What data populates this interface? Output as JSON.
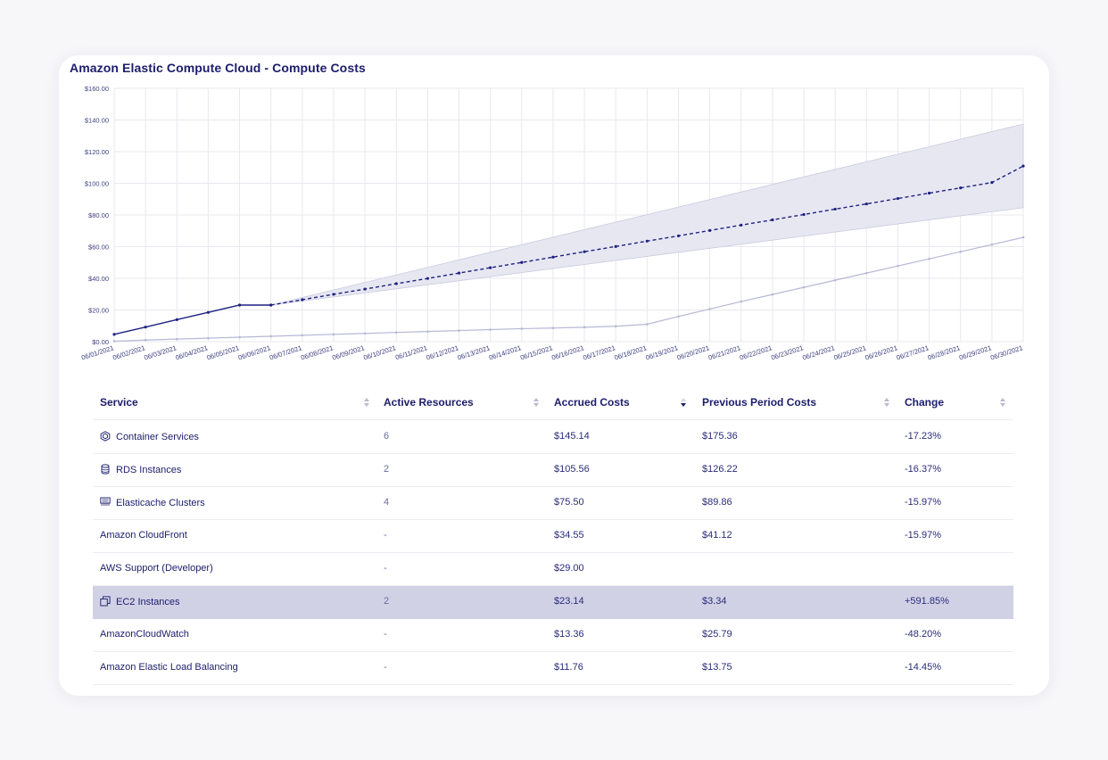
{
  "title": "Amazon Elastic Compute Cloud - Compute Costs",
  "chart_data": {
    "type": "line",
    "x": [
      "06/01/2021",
      "06/02/2021",
      "06/03/2021",
      "06/04/2021",
      "06/05/2021",
      "06/06/2021",
      "06/07/2021",
      "06/08/2021",
      "06/09/2021",
      "06/10/2021",
      "06/11/2021",
      "06/12/2021",
      "06/13/2021",
      "06/14/2021",
      "06/15/2021",
      "06/16/2021",
      "06/17/2021",
      "06/18/2021",
      "06/19/2021",
      "06/20/2021",
      "06/21/2021",
      "06/22/2021",
      "06/23/2021",
      "06/24/2021",
      "06/25/2021",
      "06/26/2021",
      "06/27/2021",
      "06/28/2021",
      "06/29/2021",
      "06/30/2021"
    ],
    "y_ticks": [
      "$0.00",
      "$20.00",
      "$40.00",
      "$60.00",
      "$80.00",
      "$100.00",
      "$120.00",
      "$140.00",
      "$160.00"
    ],
    "ylim": [
      0,
      160
    ],
    "grid": true,
    "series": [
      {
        "style": "solid",
        "color": "#1f2280",
        "values": [
          4.6,
          9.2,
          13.9,
          18.5,
          23.1,
          23.1
        ]
      },
      {
        "style": "dashed",
        "color": "#1f2280",
        "start_index": 5,
        "values": [
          23.1,
          26.5,
          29.9,
          33.2,
          36.6,
          39.9,
          43.3,
          46.7,
          50.0,
          53.4,
          56.8,
          60.1,
          63.5,
          66.8,
          70.2,
          73.6,
          76.9,
          80.3,
          83.7,
          87.0,
          90.4,
          93.8,
          97.1,
          100.5,
          110.9
        ]
      },
      {
        "style": "faint",
        "color": "#b7b8d6",
        "values": [
          0.3,
          1.0,
          1.6,
          2.2,
          2.8,
          3.4,
          4.0,
          4.6,
          5.2,
          5.8,
          6.4,
          7.0,
          7.6,
          8.2,
          8.6,
          9.1,
          9.7,
          11.0,
          15.9,
          20.6,
          25.3,
          29.8,
          34.3,
          38.8,
          43.3,
          47.8,
          52.3,
          56.8,
          61.3,
          65.9
        ]
      }
    ],
    "band": {
      "start_index": 5,
      "upper_end": 137.4,
      "lower_end": 84.6,
      "start": 23.1,
      "color": "#e7e7f2"
    }
  },
  "table": {
    "headers": [
      "Service",
      "Active Resources",
      "Accrued Costs",
      "Previous Period Costs",
      "Change"
    ],
    "rows": [
      {
        "icon": "container-icon",
        "service": "Container Services",
        "active": "6",
        "accrued": "$145.14",
        "previous": "$175.36",
        "change": "-17.23%"
      },
      {
        "icon": "database-icon",
        "service": "RDS Instances",
        "active": "2",
        "accrued": "$105.56",
        "previous": "$126.22",
        "change": "-16.37%"
      },
      {
        "icon": "cache-cluster-icon",
        "service": "Elasticache Clusters",
        "active": "4",
        "accrued": "$75.50",
        "previous": "$89.86",
        "change": "-15.97%"
      },
      {
        "icon": "",
        "service": "Amazon CloudFront",
        "active": "-",
        "accrued": "$34.55",
        "previous": "$41.12",
        "change": "-15.97%"
      },
      {
        "icon": "",
        "service": "AWS Support (Developer)",
        "active": "-",
        "accrued": "$29.00",
        "previous": "",
        "change": ""
      },
      {
        "icon": "ec2-instances-icon",
        "service": "EC2 Instances",
        "active": "2",
        "accrued": "$23.14",
        "previous": "$3.34",
        "change": "+591.85%",
        "highlighted": true
      },
      {
        "icon": "",
        "service": "AmazonCloudWatch",
        "active": "-",
        "accrued": "$13.36",
        "previous": "$25.79",
        "change": "-48.20%"
      },
      {
        "icon": "",
        "service": "Amazon Elastic Load Balancing",
        "active": "-",
        "accrued": "$11.76",
        "previous": "$13.75",
        "change": "-14.45%"
      }
    ]
  }
}
